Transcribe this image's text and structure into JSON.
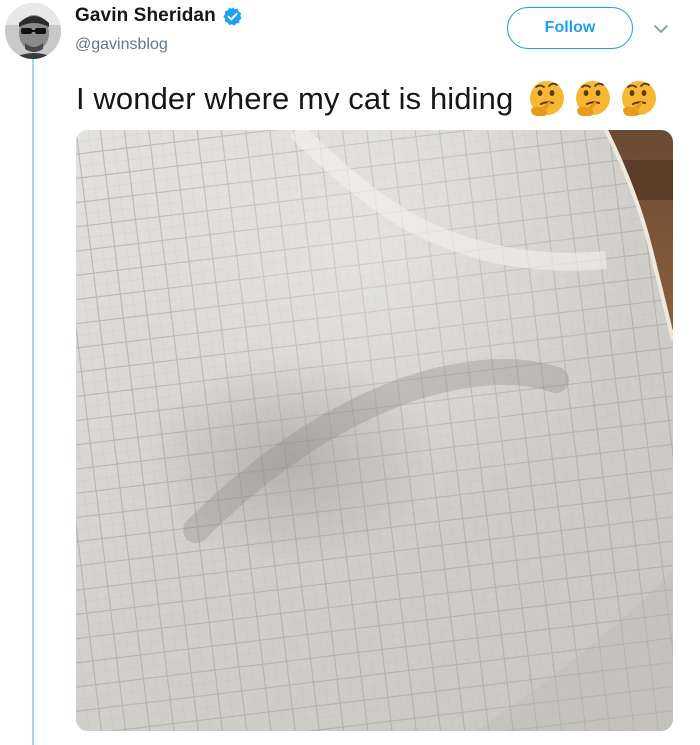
{
  "user": {
    "name": "Gavin Sheridan",
    "handle": "@gavinsblog",
    "verified": true,
    "avatar_icon": "avatar-photo"
  },
  "actions": {
    "follow_label": "Follow",
    "more_icon": "chevron-down-icon"
  },
  "tweet": {
    "text": "I wonder where my cat is hiding",
    "emojis": [
      "thinking-face",
      "thinking-face",
      "thinking-face"
    ],
    "media_icon": "quilted-bedspread-photo"
  },
  "colors": {
    "accent": "#1da1f2",
    "thread_line": "#a6d4f2",
    "secondary_text": "#657786"
  }
}
